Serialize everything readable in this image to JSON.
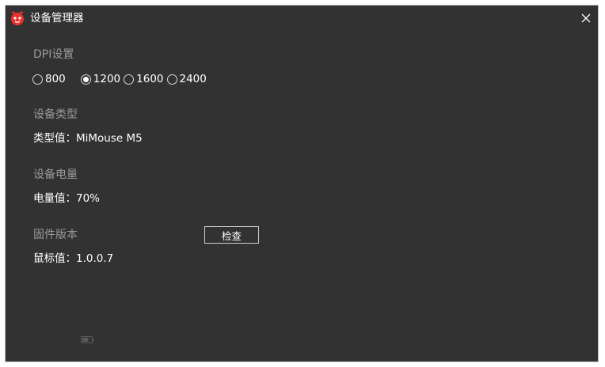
{
  "window": {
    "title": "设备管理器",
    "accent_color": "#e8312f"
  },
  "dpi": {
    "section_label": "DPI设置",
    "options": [
      "800",
      "1200",
      "1600",
      "2400"
    ],
    "selected": "1200"
  },
  "device_type": {
    "section_label": "设备类型",
    "value_text": "类型值：MiMouse M5"
  },
  "battery": {
    "section_label": "设备电量",
    "value_text": "电量值：70%",
    "level_percent": 70
  },
  "firmware": {
    "section_label": "固件版本",
    "check_button": "检查",
    "value_text": "鼠标值：1.0.0.7"
  }
}
